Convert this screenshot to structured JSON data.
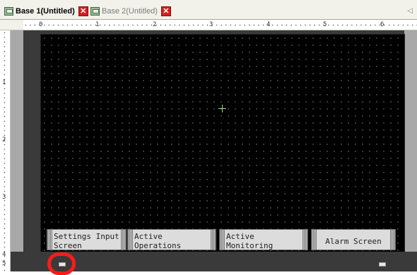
{
  "tabs": [
    {
      "label": "Base 1(Untitled)",
      "active": true
    },
    {
      "label": "Base 2(Untitled)",
      "active": false
    }
  ],
  "ruler": {
    "horizontal": [
      "0",
      "1",
      "2",
      "3",
      "4",
      "5",
      "6"
    ],
    "vertical": [
      "1",
      "2",
      "3",
      "4",
      "5"
    ]
  },
  "switches": [
    {
      "label": "Settings Input\nScreen"
    },
    {
      "label": "Active Operations\nScreen"
    },
    {
      "label": "Active Monitoring\nScreen"
    },
    {
      "label": "Alarm Screen"
    }
  ],
  "colors": {
    "canvas": "#000000",
    "workspace": "#3a3a3a",
    "crosshair": "#9edc6a",
    "close": "#d71d1d",
    "highlight": "#ff1a1a"
  },
  "icons": {
    "tab": "screen-icon",
    "close": "close-icon",
    "scroll": "chevron-left-icon"
  }
}
